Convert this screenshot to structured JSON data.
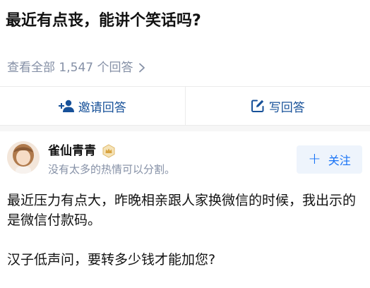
{
  "question": {
    "title": "最近有点丧，能讲个笑话吗?"
  },
  "answers_link": {
    "label": "查看全部 1,547 个回答",
    "icon": "chevron-right-icon"
  },
  "actions": {
    "invite_label": "邀请回答",
    "invite_icon": "invite-person-icon",
    "write_label": "写回答",
    "write_icon": "edit-icon",
    "accent_color": "#175199"
  },
  "answer": {
    "author_name": "雀仙青青",
    "author_badge_icon": "crown-badge-icon",
    "author_bio": "没有太多的热情可以分割。",
    "follow_label": "关注",
    "follow_icon": "plus-icon",
    "paragraphs": [
      "最近压力有点大，昨晚相亲跟人家换微信的时候，我出示的是微信付款码。",
      "汉子低声问，要转多少钱才能加您?"
    ]
  }
}
